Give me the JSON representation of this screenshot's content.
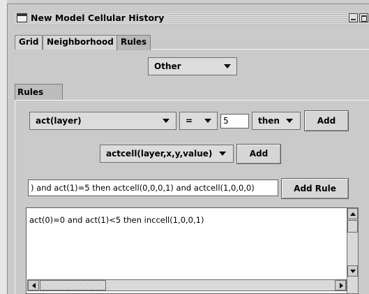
{
  "window": {
    "title": "New Model Cellular History"
  },
  "tabs": [
    {
      "label": "Grid"
    },
    {
      "label": "Neighborhood"
    },
    {
      "label": "Rules",
      "active": true
    }
  ],
  "category_select": {
    "value": "Other"
  },
  "subtab": {
    "label": "Rules"
  },
  "condition_row": {
    "function_select": "act(layer)",
    "operator_select": "=",
    "value_input": "5",
    "connector_select": "then",
    "add_label": "Add"
  },
  "action_row": {
    "action_select": "actcell(layer,x,y,value)",
    "add_label": "Add"
  },
  "rule_row": {
    "rule_input": ") and act(1)=5 then actcell(0,0,0,1) and actcell(1,0,0,0)",
    "add_rule_label": "Add Rule"
  },
  "rules_text": "act(0)=0 and act(1)<5 then inccell(1,0,0,1)",
  "icons": [
    "window-icon",
    "minimize-icon",
    "maximize-icon",
    "dropdown-arrow-icon",
    "scroll-up-icon",
    "scroll-down-icon",
    "scroll-left-icon",
    "scroll-right-icon"
  ],
  "colors": {
    "background": "#cacaca",
    "field": "#ffffff",
    "border": "#5e5e5e"
  }
}
